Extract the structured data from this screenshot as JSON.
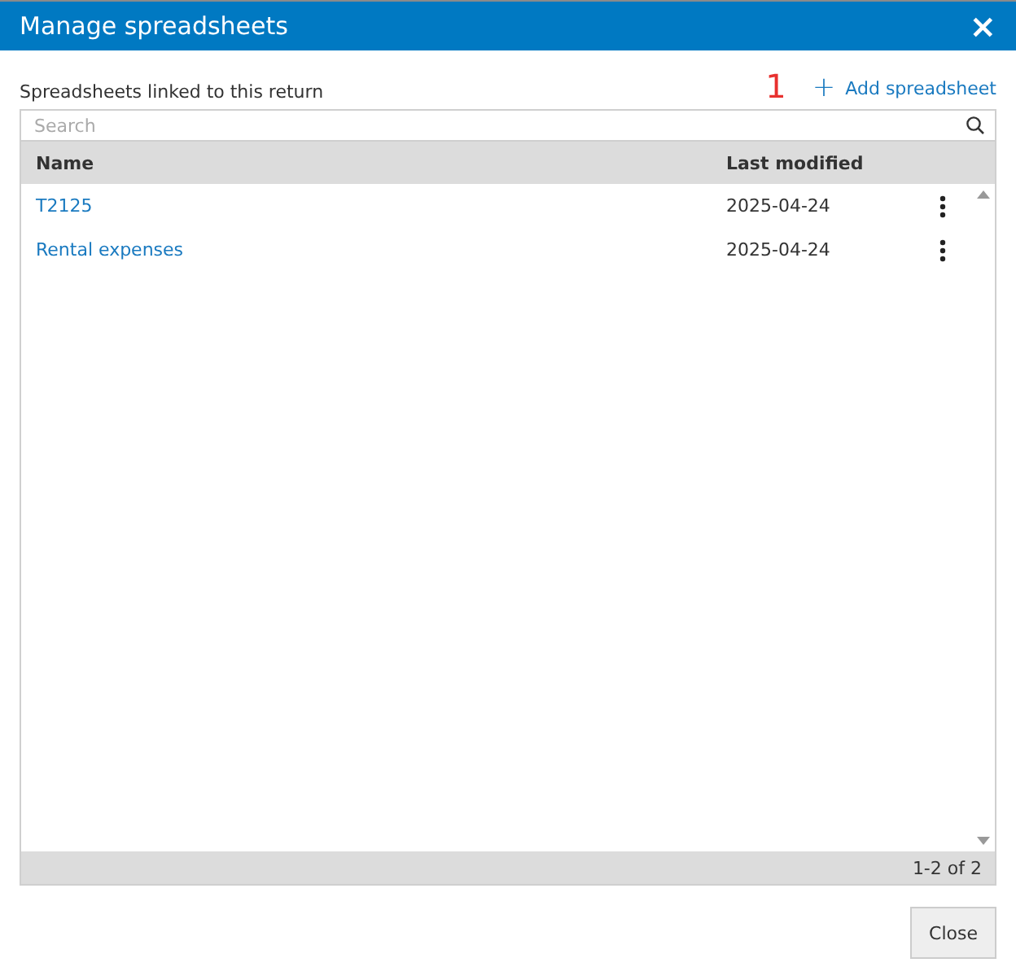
{
  "window": {
    "title": "Manage spreadsheets",
    "close": "×"
  },
  "subtitle": "Spreadsheets linked to this return",
  "annotation": "1",
  "add_button": {
    "icon": "+",
    "label": "Add spreadsheet"
  },
  "search": {
    "placeholder": "Search"
  },
  "table": {
    "columns": [
      "Name",
      "Last modified"
    ],
    "rows": [
      {
        "name": "T2125",
        "modified": "2025-04-24"
      },
      {
        "name": "Rental expenses",
        "modified": "2025-04-24"
      }
    ],
    "footer": "1-2 of 2"
  },
  "buttons": [
    "Close"
  ]
}
